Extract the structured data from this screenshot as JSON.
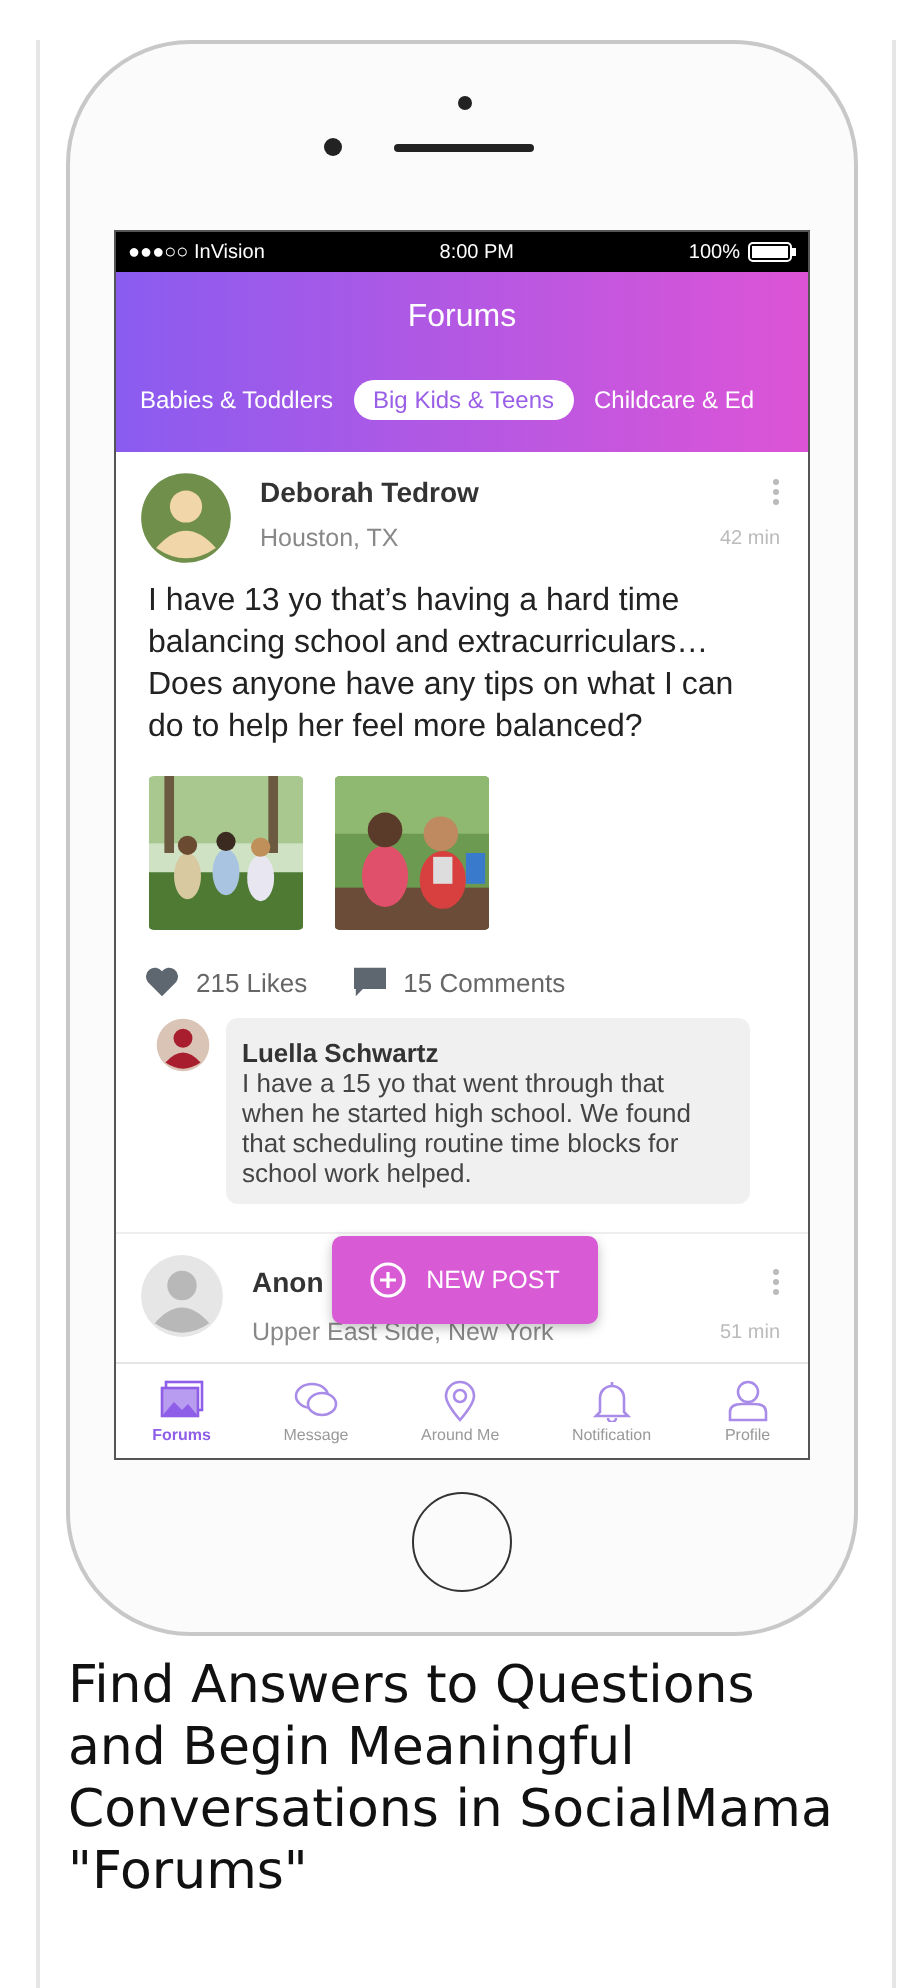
{
  "status_bar": {
    "carrier": "●●●○○ InVision",
    "time": "8:00 PM",
    "battery": "100%"
  },
  "header": {
    "title": "Forums"
  },
  "tabs": [
    {
      "label": "Babies & Toddlers",
      "selected": false
    },
    {
      "label": "Big Kids & Teens",
      "selected": true
    },
    {
      "label": "Childcare & Ed",
      "selected": false
    }
  ],
  "posts": [
    {
      "author": "Deborah Tedrow",
      "location": "Houston, TX",
      "time": "42 min",
      "text": "I have 13 yo that’s having a hard time balancing school and extracurriculars… Does anyone have any tips on what I can do to help her feel more balanced?",
      "likes": "215 Likes",
      "comments": "15 Comments",
      "comment": {
        "author": "Luella Schwartz",
        "text": "I have a 15 yo that went through that when he started high school. We found that scheduling routine time blocks for school work helped."
      }
    },
    {
      "author": "Anon",
      "location": "Upper East Side, New York",
      "time": "51 min"
    }
  ],
  "fab": {
    "label": "NEW POST"
  },
  "nav": [
    {
      "label": "Forums",
      "kind": "gallery",
      "selected": true
    },
    {
      "label": "Message",
      "kind": "chat",
      "selected": false
    },
    {
      "label": "Around Me",
      "kind": "pin",
      "selected": false
    },
    {
      "label": "Notification",
      "kind": "bell",
      "selected": false
    },
    {
      "label": "Profile",
      "kind": "person",
      "selected": false
    }
  ],
  "caption": "Find Answers to Questions and Begin Meaningful Conversations in SocialMama \"Forums\""
}
